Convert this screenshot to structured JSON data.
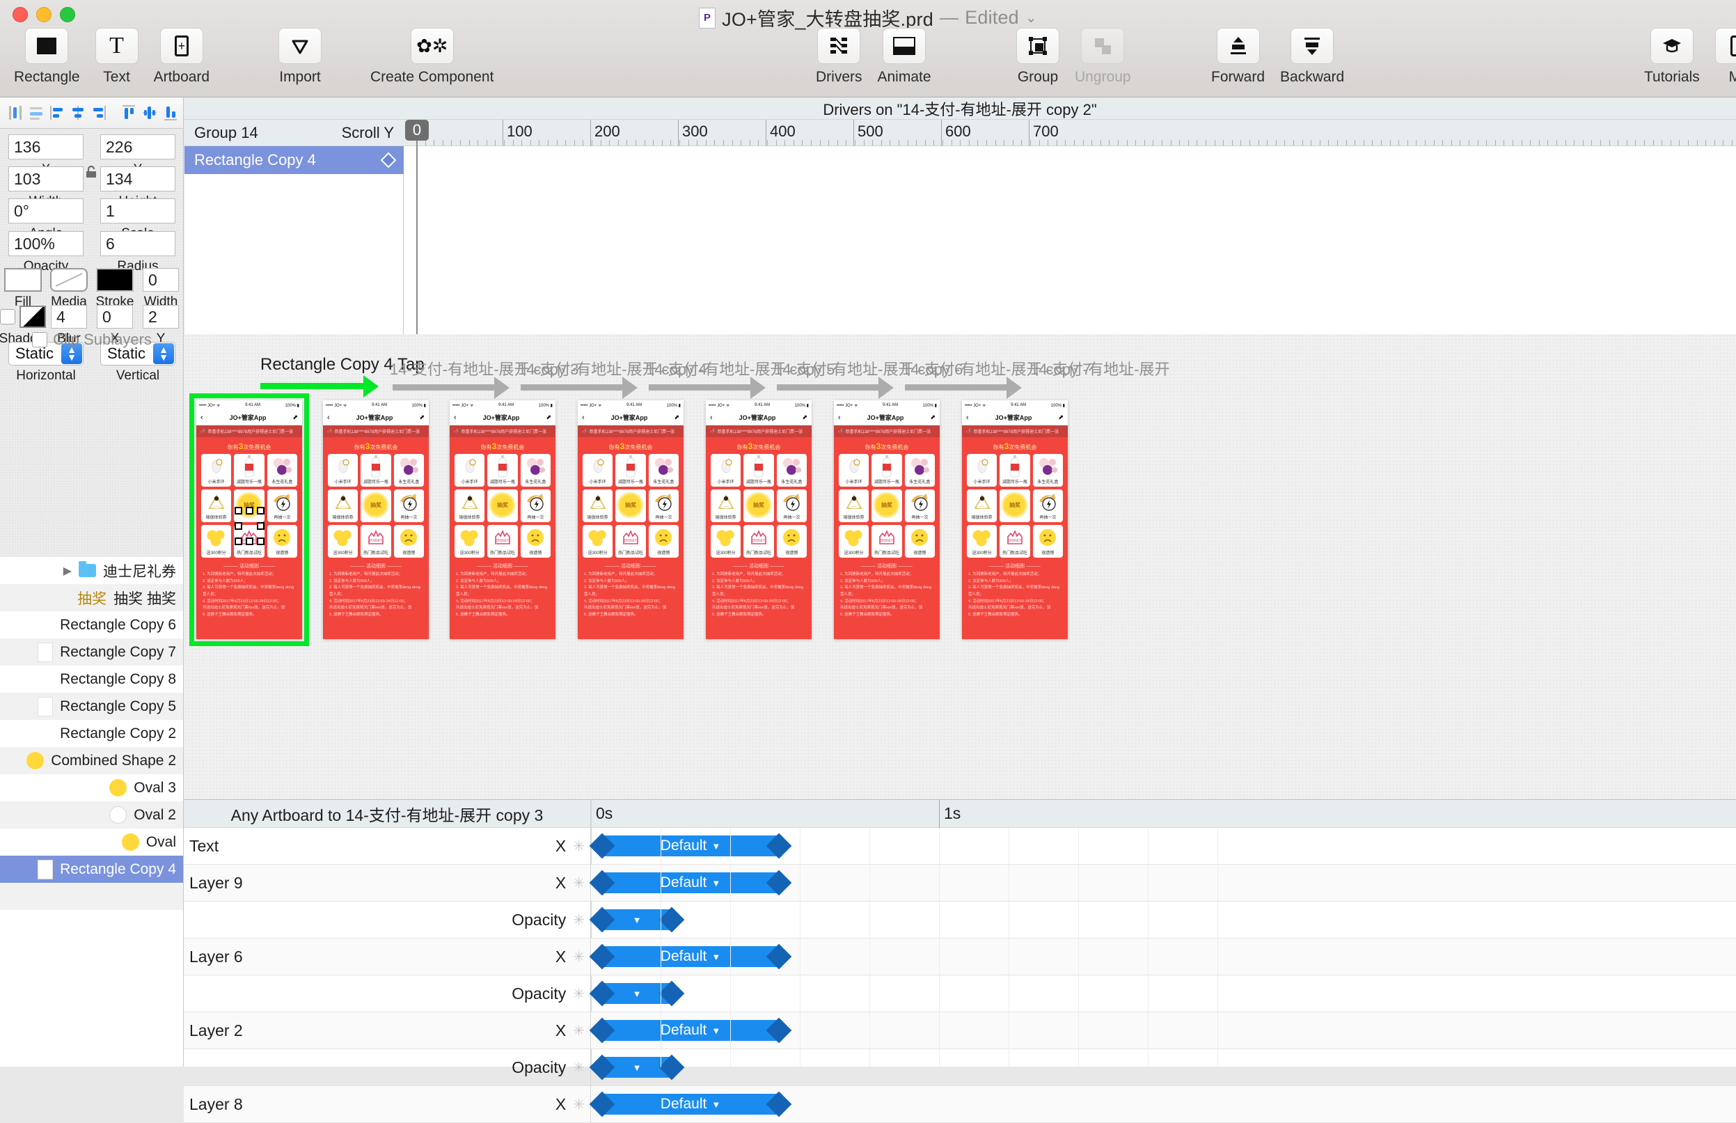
{
  "window": {
    "title": "JO+管家_大转盘抽奖.prd",
    "separator": "—",
    "edited": "Edited",
    "doc_icon": "principle-doc-icon"
  },
  "toolbar": {
    "left_group": [
      {
        "label": "Rectangle",
        "icon": "rectangle-icon",
        "enabled": true
      },
      {
        "label": "Text",
        "icon": "text-icon",
        "enabled": true
      },
      {
        "label": "Artboard",
        "icon": "artboard-icon",
        "enabled": true
      }
    ],
    "import_group": [
      {
        "label": "Import",
        "icon": "import-icon",
        "enabled": true
      },
      {
        "label": "Create Component",
        "icon": "create-component-icon",
        "enabled": true
      }
    ],
    "anim_group": [
      {
        "label": "Drivers",
        "icon": "drivers-icon",
        "enabled": true
      },
      {
        "label": "Animate",
        "icon": "animate-icon",
        "enabled": true
      }
    ],
    "group_group": [
      {
        "label": "Group",
        "icon": "group-icon",
        "enabled": true
      },
      {
        "label": "Ungroup",
        "icon": "ungroup-icon",
        "enabled": false
      }
    ],
    "order_group": [
      {
        "label": "Forward",
        "icon": "forward-icon",
        "enabled": true
      },
      {
        "label": "Backward",
        "icon": "backward-icon",
        "enabled": true
      }
    ],
    "right_group": [
      {
        "label": "Tutorials",
        "icon": "graduation-cap-icon",
        "enabled": true
      },
      {
        "label": "Mi",
        "icon": "mirror-icon",
        "enabled": true
      }
    ]
  },
  "align_tools": [
    "align-left-icon",
    "align-center-h-icon",
    "distribute-left-icon",
    "distribute-center-icon",
    "distribute-right-icon",
    "align-top-icon",
    "align-middle-icon",
    "align-bottom-icon"
  ],
  "inspector": {
    "x": {
      "value": "136",
      "label": "X"
    },
    "y": {
      "value": "226",
      "label": "Y"
    },
    "width": {
      "value": "103",
      "label": "Width"
    },
    "height": {
      "value": "134",
      "label": "Height"
    },
    "angle": {
      "value": "0°",
      "label": "Angle"
    },
    "scale": {
      "value": "1",
      "label": "Scale"
    },
    "opacity": {
      "value": "100%",
      "label": "Opacity"
    },
    "radius": {
      "value": "6",
      "label": "Radius"
    },
    "fill": {
      "label": "Fill"
    },
    "media": {
      "label": "Media"
    },
    "stroke": {
      "label": "Stroke"
    },
    "stroke_width": {
      "value": "0",
      "label": "Width"
    },
    "shadow": {
      "label": "Shadow"
    },
    "blur": {
      "value": "4",
      "label": "Blur"
    },
    "shadow_x": {
      "value": "0",
      "label": "X"
    },
    "shadow_y": {
      "value": "2",
      "label": "Y"
    },
    "horizontal": {
      "value": "Static",
      "label": "Horizontal"
    },
    "vertical": {
      "value": "Static",
      "label": "Vertical"
    },
    "clip_sublayers": "Clip Sublayers"
  },
  "layers": [
    {
      "name": "迪士尼礼券",
      "icon": "folder-icon",
      "disclosure": true,
      "state": "normal"
    },
    {
      "name": "抽奖 抽奖",
      "prefix": "抽奖",
      "icon": "text-layer-icon",
      "state": "alt"
    },
    {
      "name": "Rectangle Copy 6",
      "icon": "none",
      "state": "normal"
    },
    {
      "name": "Rectangle Copy 7",
      "icon": "thumb-white",
      "state": "alt"
    },
    {
      "name": "Rectangle Copy 8",
      "icon": "none",
      "state": "normal"
    },
    {
      "name": "Rectangle Copy 5",
      "icon": "thumb-white",
      "state": "alt"
    },
    {
      "name": "Rectangle Copy 2",
      "icon": "none",
      "state": "normal"
    },
    {
      "name": "Combined Shape 2",
      "icon": "dot-yellow",
      "state": "alt"
    },
    {
      "name": "Oval 3",
      "icon": "dot-yellow",
      "state": "normal"
    },
    {
      "name": "Oval 2",
      "icon": "dot-white",
      "state": "alt"
    },
    {
      "name": "Oval",
      "icon": "dot-yellow",
      "state": "normal"
    },
    {
      "name": "Rectangle Copy 4",
      "icon": "thumb-white",
      "state": "selected"
    },
    {
      "name": "",
      "icon": "none",
      "state": "alt"
    }
  ],
  "drivers": {
    "header": "Drivers on \"14-支付-有地址-展开 copy 2\"",
    "group_name": "Group 14",
    "group_axis": "Scroll Y",
    "selected_name": "Rectangle Copy 4",
    "playhead_value": "0",
    "ruler_ticks": [
      "0",
      "100",
      "200",
      "300",
      "400",
      "500",
      "600",
      "700"
    ]
  },
  "canvas": {
    "tap_label": "Rectangle Copy 4 Tap",
    "artboard_flows": [
      "14-支付-有地址-展开 copy 3",
      "14-支付-有地址-展开 copy 4",
      "14-支付-有地址-展开 copy 5",
      "14-支付-有地址-展开 copy 6",
      "14-支付-有地址-展开 copy 7",
      "14-支付-有地址-展开"
    ]
  },
  "phone": {
    "status": {
      "signal": "•••••",
      "carrier": "JO+",
      "wifi": "wifi-icon",
      "time": "9:41 AM",
      "battery": "100%"
    },
    "nav": {
      "back": "back-chevron-icon",
      "title": "JO+管家App",
      "share": "share-icon"
    },
    "notice": {
      "icon": "megaphone-icon",
      "text": "恭喜手机138****8978用户获得迪士尼门票一张"
    },
    "free_chances_pre": "你有",
    "free_chances_num": "3",
    "free_chances_post": "次免费机会",
    "prizes": [
      {
        "label": "小米手环",
        "icon": "watch-icon"
      },
      {
        "label": "减脂可乐一瓶",
        "icon": "bottle-icon"
      },
      {
        "label": "永生花礼盒",
        "icon": "flower-icon"
      },
      {
        "label": "瑜伽体验券",
        "icon": "yoga-icon"
      },
      {
        "label": "抽奖",
        "icon": "spin-button"
      },
      {
        "label": "再抽一次",
        "icon": "lightning-icon"
      },
      {
        "label": "送300积分",
        "icon": "coins-icon"
      },
      {
        "label": "热门新品试吃",
        "icon": "disney-icon"
      },
      {
        "label": "很遗憾",
        "icon": "sad-face-icon"
      }
    ],
    "rules_title": "活动细则",
    "rules": [
      "1. 为回馈新老用户，特开展此次抽奖活动；",
      "2. 设定参与人数为500人；",
      "3. 每人可获得一个免费抽奖机会，中奖概率deng deng营人员；",
      "4. 活动时间2017年6月23日12:00-24日12:00；",
      "共送出迪士尼免费观光门票xxx张，送完为止，加",
      "5. 送狮子王舞台剧免预定服务。"
    ]
  },
  "timeline": {
    "header": "Any Artboard to 14-支付-有地址-展开 copy 3",
    "time_labels": [
      "0s",
      "1s"
    ],
    "rows": [
      {
        "name": "Text",
        "prop": "X",
        "bar": "Default",
        "wide": true
      },
      {
        "name": "Layer 9",
        "prop": "X",
        "bar": "Default",
        "wide": true
      },
      {
        "name": "",
        "prop": "Opacity",
        "bar": "",
        "wide": false
      },
      {
        "name": "Layer 6",
        "prop": "X",
        "bar": "Default",
        "wide": true
      },
      {
        "name": "",
        "prop": "Opacity",
        "bar": "",
        "wide": false
      },
      {
        "name": "Layer 2",
        "prop": "X",
        "bar": "Default",
        "wide": true
      },
      {
        "name": "",
        "prop": "Opacity",
        "bar": "",
        "wide": false
      },
      {
        "name": "Layer 8",
        "prop": "X",
        "bar": "Default",
        "wide": true
      }
    ]
  },
  "colors": {
    "accent_blue": "#1a8cf0",
    "selection_blue": "#7b93dd",
    "flow_green": "#00e828",
    "phone_red": "#f2453d",
    "gold": "#ffd93b"
  }
}
